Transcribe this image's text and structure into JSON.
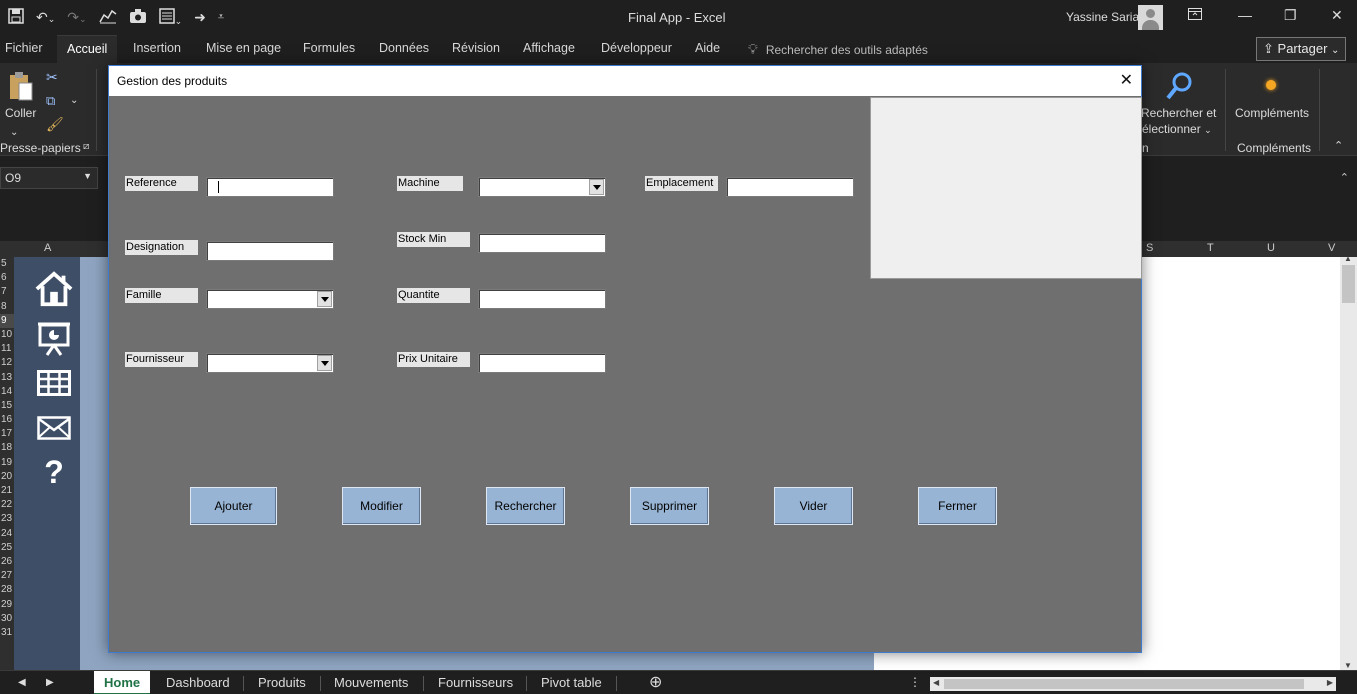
{
  "window": {
    "app_title": "Final App  -  Excel",
    "user_name": "Yassine Saria"
  },
  "ribbon_tabs": [
    "Fichier",
    "Accueil",
    "Insertion",
    "Mise en page",
    "Formules",
    "Données",
    "Révision",
    "Affichage",
    "Développeur",
    "Aide"
  ],
  "active_ribbon_tab": "Accueil",
  "tell_me_placeholder": "Rechercher des outils adaptés",
  "share_label": "Partager",
  "ribbon": {
    "paste_label": "Coller",
    "clipboard_group": "Presse-papiers",
    "find_select_line1": "Rechercher et",
    "find_select_line2": "électionner",
    "editing_group_fragment": "n",
    "addins_label": "Compléments",
    "addins_group": "Compléments"
  },
  "name_box": "O9",
  "column_headers": [
    "A",
    "S",
    "T",
    "U",
    "V"
  ],
  "row_numbers": [
    "5",
    "6",
    "7",
    "8",
    "9",
    "10",
    "11",
    "12",
    "13",
    "14",
    "15",
    "16",
    "17",
    "18",
    "19",
    "20",
    "21",
    "22",
    "23",
    "24",
    "25",
    "26",
    "27",
    "28",
    "29",
    "30",
    "31"
  ],
  "nav_icons": [
    "home-icon",
    "presentation-chart-icon",
    "table-icon",
    "mail-icon",
    "help-icon"
  ],
  "sheet_tabs": [
    "Home",
    "Dashboard",
    "Produits",
    "Mouvements",
    "Fournisseurs",
    "Pivot table"
  ],
  "active_sheet": "Home",
  "dialog": {
    "title": "Gestion des produits",
    "fields": {
      "reference": {
        "label": "Reference",
        "value": ""
      },
      "designation": {
        "label": "Designation",
        "value": ""
      },
      "famille": {
        "label": "Famille",
        "value": ""
      },
      "fournisseur": {
        "label": "Fournisseur",
        "value": ""
      },
      "machine": {
        "label": "Machine",
        "value": ""
      },
      "stock_min": {
        "label": "Stock Min",
        "value": ""
      },
      "quantite": {
        "label": "Quantite",
        "value": ""
      },
      "prix_unitaire": {
        "label": "Prix Unitaire",
        "value": ""
      },
      "emplacement": {
        "label": "Emplacement",
        "value": ""
      }
    },
    "buttons": {
      "ajouter": "Ajouter",
      "modifier": "Modifier",
      "rechercher": "Rechercher",
      "supprimer": "Supprimer",
      "vider": "Vider",
      "fermer": "Fermer"
    }
  },
  "colors": {
    "dialog_bg": "#6f6f6f",
    "button_bg": "#98b4d4",
    "nav_pane": "#3e4e66",
    "sheet_bg": "#8ea4c0",
    "excel_green": "#217346"
  }
}
